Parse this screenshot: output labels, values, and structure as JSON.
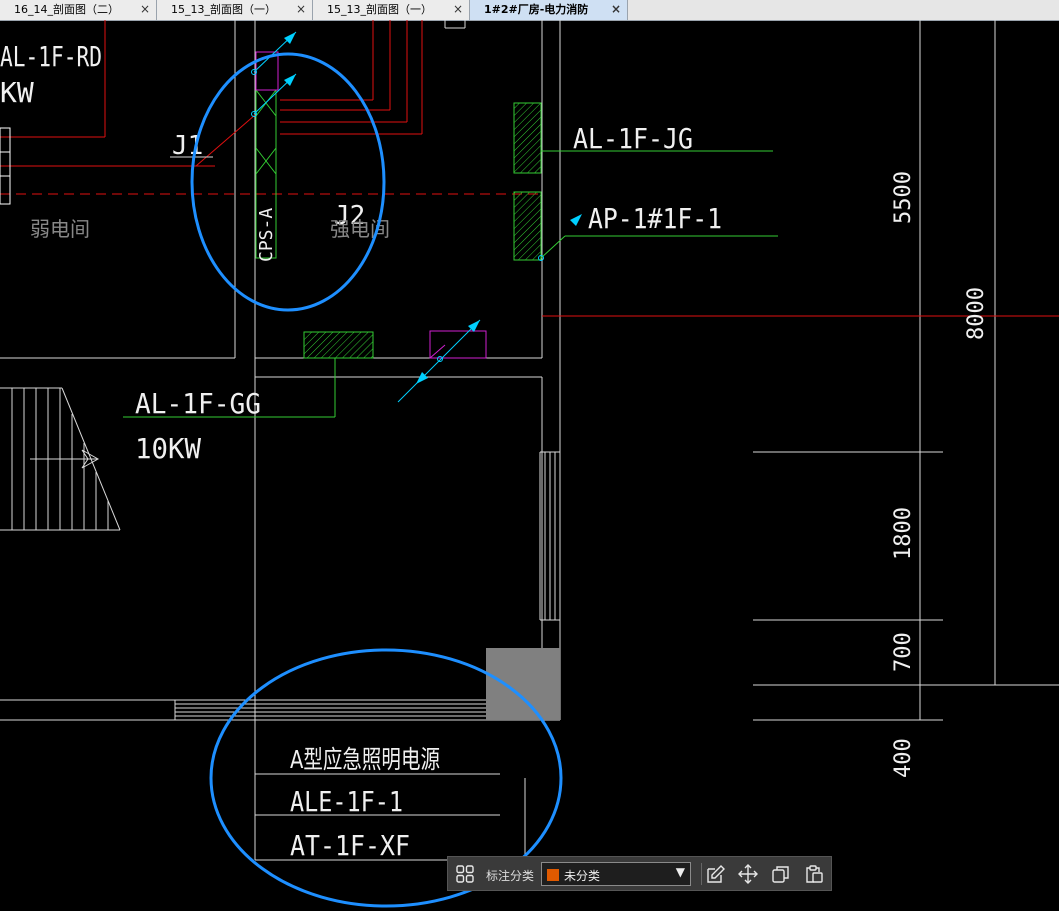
{
  "tabs": [
    {
      "label": "16_14_剖面图（二）",
      "close": "×"
    },
    {
      "label": "15_13_剖面图（一）",
      "close": "×"
    },
    {
      "label": "15_13_剖面图（一）",
      "close": "×"
    },
    {
      "label": "1#2#厂房-电力消防",
      "close": "×",
      "active": true
    }
  ],
  "drawing": {
    "labels": {
      "al_1f_rd": "AL-1F-RD",
      "kw_top": "KW",
      "j1": "J1",
      "j2": "J2",
      "ruodianjian": "弱电间",
      "qiangdianjian": "强电间",
      "cps": "CPS-A",
      "al_1f_jg": "AL-1F-JG",
      "ap_1f_1": "AP-1#1F-1",
      "al_1f_gg": "AL-1F-GG",
      "kw_10": "10KW",
      "emergency": "A型应急照明电源",
      "ale_1f_1": "ALE-1F-1",
      "at_1f_xf": "AT-1F-XF"
    },
    "dimensions": {
      "d5500": "5500",
      "d8000": "8000",
      "d1800": "1800",
      "d700": "700",
      "d400": "400"
    }
  },
  "toolbar": {
    "category_label": "标注分类",
    "category_value": "未分类",
    "category_color": "#e05a00",
    "icons": [
      "grid-icon",
      "edit-icon",
      "move-icon",
      "copy-icon",
      "paste-icon"
    ]
  },
  "colors": {
    "tab_bar": "#e6e6e6",
    "tab_active": "#cfe0f3",
    "canvas": "#000000",
    "wall": "#d8d8d8",
    "red_wire": "#e01010",
    "green_wire": "#33cc33",
    "magenta": "#d020d0",
    "cyan": "#00d0ff",
    "highlight_circle": "#1e8fff"
  }
}
